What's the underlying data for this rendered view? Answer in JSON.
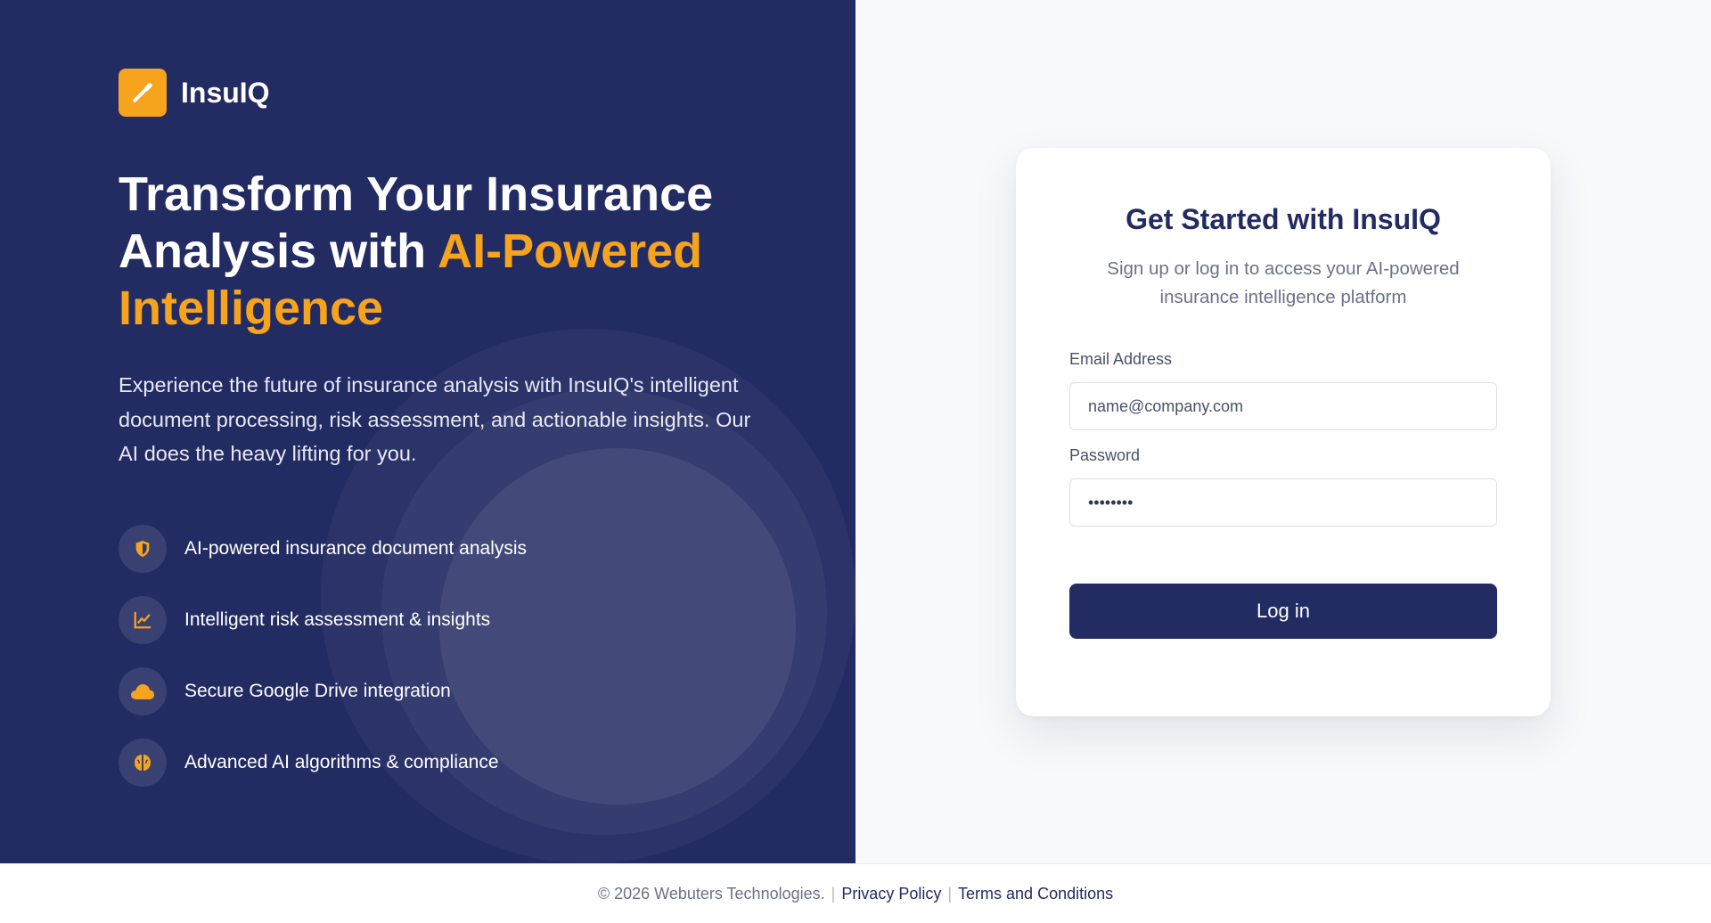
{
  "brand": {
    "name": "InsuIQ",
    "logo_icon": "pencil-icon",
    "logo_color": "#f6a31d"
  },
  "hero": {
    "headline_part1": "Transform Your Insurance Analysis with ",
    "headline_accent": "AI-Powered Intelligence",
    "description": "Experience the future of insurance analysis with InsuIQ's intelligent document processing, risk assessment, and actionable insights. Our AI does the heavy lifting for you."
  },
  "features": [
    {
      "icon": "shield-icon",
      "label": "AI-powered insurance document analysis"
    },
    {
      "icon": "chart-line-icon",
      "label": "Intelligent risk assessment & insights"
    },
    {
      "icon": "cloud-icon",
      "label": "Secure Google Drive integration"
    },
    {
      "icon": "brain-icon",
      "label": "Advanced AI algorithms & compliance"
    }
  ],
  "login": {
    "title": "Get Started with InsuIQ",
    "subtitle": "Sign up or log in to access your AI-powered insurance intelligence platform",
    "email_label": "Email Address",
    "email_placeholder": "name@company.com",
    "password_label": "Password",
    "password_value": "••••••••",
    "submit_label": "Log in"
  },
  "footer": {
    "copyright": "© 2026 Webuters Technologies.",
    "separator": "|",
    "privacy_link": "Privacy Policy",
    "terms_link": "Terms and Conditions"
  },
  "colors": {
    "navy": "#232b63",
    "accent": "#f6a31d",
    "panel_background": "#f8f9fb"
  }
}
